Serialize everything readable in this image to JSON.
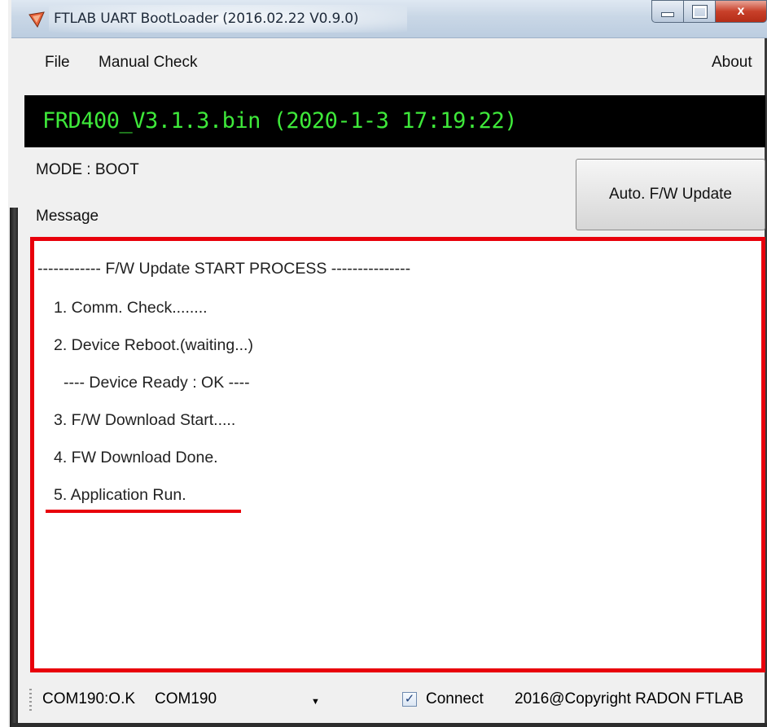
{
  "window": {
    "title": "FTLAB UART BootLoader (2016.02.22 V0.9.0)",
    "controls": {
      "minimize": "minimize",
      "maximize": "maximize",
      "close": "x"
    }
  },
  "menu": {
    "file": "File",
    "manual_check": "Manual Check",
    "about": "About"
  },
  "banner": {
    "firmware": "FRD400_V3.1.3.bin (2020-1-3 17:19:22)",
    "text_color": "#3ee83a",
    "background": "#000000"
  },
  "mode": "MODE : BOOT",
  "message_label": "Message",
  "update_button": "Auto. F/W Update",
  "log": {
    "highlight_color": "#e8000b",
    "lines": [
      "------------ F/W Update START PROCESS ---------------",
      "1. Comm. Check........",
      "2. Device Reboot.(waiting...)",
      "---- Device Ready : OK ----",
      "3. F/W Download Start.....",
      "4. FW Download Done.",
      "5. Application Run."
    ]
  },
  "status": {
    "com_status": "COM190:O.K",
    "port": "COM190",
    "connect_checked": true,
    "connect_label": "Connect",
    "copyright": "2016@Copyright RADON FTLAB"
  }
}
